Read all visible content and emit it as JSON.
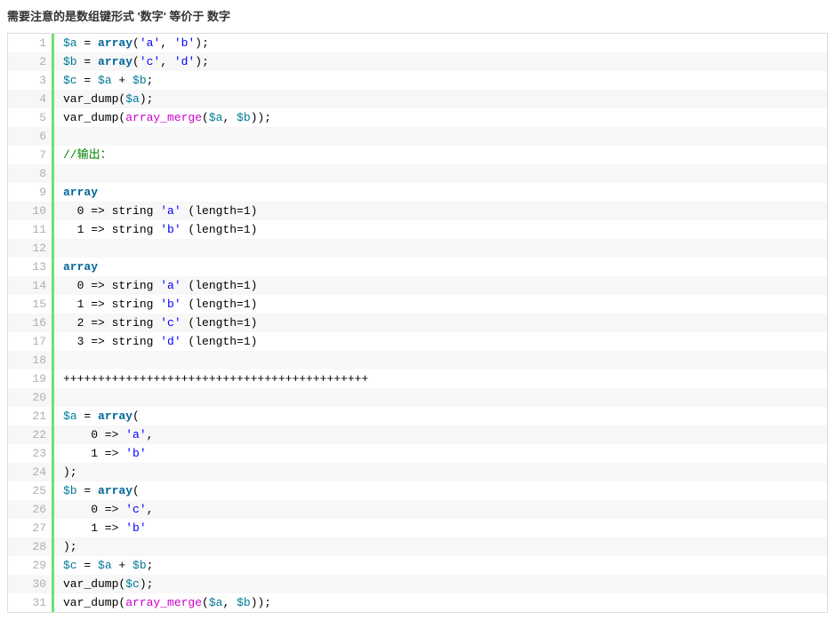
{
  "heading": "需要注意的是数组键形式 '数字' 等价于 数字",
  "lines": [
    {
      "n": "1",
      "tokens": [
        [
          "t-var",
          "$a"
        ],
        [
          "t-pl",
          " = "
        ],
        [
          "t-kw",
          "array"
        ],
        [
          "t-pl",
          "("
        ],
        [
          "t-str",
          "'a'"
        ],
        [
          "t-pl",
          ", "
        ],
        [
          "t-str",
          "'b'"
        ],
        [
          "t-pl",
          ");"
        ]
      ]
    },
    {
      "n": "2",
      "tokens": [
        [
          "t-var",
          "$b"
        ],
        [
          "t-pl",
          " = "
        ],
        [
          "t-kw",
          "array"
        ],
        [
          "t-pl",
          "("
        ],
        [
          "t-str",
          "'c'"
        ],
        [
          "t-pl",
          ", "
        ],
        [
          "t-str",
          "'d'"
        ],
        [
          "t-pl",
          ");"
        ]
      ]
    },
    {
      "n": "3",
      "tokens": [
        [
          "t-var",
          "$c"
        ],
        [
          "t-pl",
          " = "
        ],
        [
          "t-var",
          "$a"
        ],
        [
          "t-pl",
          " + "
        ],
        [
          "t-var",
          "$b"
        ],
        [
          "t-pl",
          ";"
        ]
      ]
    },
    {
      "n": "4",
      "tokens": [
        [
          "t-pl",
          "var_dump("
        ],
        [
          "t-var",
          "$a"
        ],
        [
          "t-pl",
          ");"
        ]
      ]
    },
    {
      "n": "5",
      "tokens": [
        [
          "t-pl",
          "var_dump("
        ],
        [
          "t-fn",
          "array_merge"
        ],
        [
          "t-pl",
          "("
        ],
        [
          "t-var",
          "$a"
        ],
        [
          "t-pl",
          ", "
        ],
        [
          "t-var",
          "$b"
        ],
        [
          "t-pl",
          "));"
        ]
      ]
    },
    {
      "n": "6",
      "tokens": [
        [
          "t-pl",
          ""
        ]
      ]
    },
    {
      "n": "7",
      "tokens": [
        [
          "t-com",
          "//输出："
        ]
      ]
    },
    {
      "n": "8",
      "tokens": [
        [
          "t-pl",
          ""
        ]
      ]
    },
    {
      "n": "9",
      "tokens": [
        [
          "t-kw",
          "array"
        ]
      ]
    },
    {
      "n": "10",
      "tokens": [
        [
          "t-pl",
          "  0 => string "
        ],
        [
          "t-str",
          "'a'"
        ],
        [
          "t-pl",
          " (length=1)"
        ]
      ]
    },
    {
      "n": "11",
      "tokens": [
        [
          "t-pl",
          "  1 => string "
        ],
        [
          "t-str",
          "'b'"
        ],
        [
          "t-pl",
          " (length=1)"
        ]
      ]
    },
    {
      "n": "12",
      "tokens": [
        [
          "t-pl",
          ""
        ]
      ]
    },
    {
      "n": "13",
      "tokens": [
        [
          "t-kw",
          "array"
        ]
      ]
    },
    {
      "n": "14",
      "tokens": [
        [
          "t-pl",
          "  0 => string "
        ],
        [
          "t-str",
          "'a'"
        ],
        [
          "t-pl",
          " (length=1)"
        ]
      ]
    },
    {
      "n": "15",
      "tokens": [
        [
          "t-pl",
          "  1 => string "
        ],
        [
          "t-str",
          "'b'"
        ],
        [
          "t-pl",
          " (length=1)"
        ]
      ]
    },
    {
      "n": "16",
      "tokens": [
        [
          "t-pl",
          "  2 => string "
        ],
        [
          "t-str",
          "'c'"
        ],
        [
          "t-pl",
          " (length=1)"
        ]
      ]
    },
    {
      "n": "17",
      "tokens": [
        [
          "t-pl",
          "  3 => string "
        ],
        [
          "t-str",
          "'d'"
        ],
        [
          "t-pl",
          " (length=1)"
        ]
      ]
    },
    {
      "n": "18",
      "tokens": [
        [
          "t-pl",
          ""
        ]
      ]
    },
    {
      "n": "19",
      "tokens": [
        [
          "t-pl",
          "++++++++++++++++++++++++++++++++++++++++++++"
        ]
      ]
    },
    {
      "n": "20",
      "tokens": [
        [
          "t-pl",
          ""
        ]
      ]
    },
    {
      "n": "21",
      "tokens": [
        [
          "t-var",
          "$a"
        ],
        [
          "t-pl",
          " = "
        ],
        [
          "t-kw",
          "array"
        ],
        [
          "t-pl",
          "("
        ]
      ]
    },
    {
      "n": "22",
      "tokens": [
        [
          "t-pl",
          "    0 => "
        ],
        [
          "t-str",
          "'a'"
        ],
        [
          "t-pl",
          ","
        ]
      ]
    },
    {
      "n": "23",
      "tokens": [
        [
          "t-pl",
          "    1 => "
        ],
        [
          "t-str",
          "'b'"
        ]
      ]
    },
    {
      "n": "24",
      "tokens": [
        [
          "t-pl",
          ");"
        ]
      ]
    },
    {
      "n": "25",
      "tokens": [
        [
          "t-var",
          "$b"
        ],
        [
          "t-pl",
          " = "
        ],
        [
          "t-kw",
          "array"
        ],
        [
          "t-pl",
          "("
        ]
      ]
    },
    {
      "n": "26",
      "tokens": [
        [
          "t-pl",
          "    0 => "
        ],
        [
          "t-str",
          "'c'"
        ],
        [
          "t-pl",
          ","
        ]
      ]
    },
    {
      "n": "27",
      "tokens": [
        [
          "t-pl",
          "    1 => "
        ],
        [
          "t-str",
          "'b'"
        ]
      ]
    },
    {
      "n": "28",
      "tokens": [
        [
          "t-pl",
          ");"
        ]
      ]
    },
    {
      "n": "29",
      "tokens": [
        [
          "t-var",
          "$c"
        ],
        [
          "t-pl",
          " = "
        ],
        [
          "t-var",
          "$a"
        ],
        [
          "t-pl",
          " + "
        ],
        [
          "t-var",
          "$b"
        ],
        [
          "t-pl",
          ";"
        ]
      ]
    },
    {
      "n": "30",
      "tokens": [
        [
          "t-pl",
          "var_dump("
        ],
        [
          "t-var",
          "$c"
        ],
        [
          "t-pl",
          ");"
        ]
      ]
    },
    {
      "n": "31",
      "tokens": [
        [
          "t-pl",
          "var_dump("
        ],
        [
          "t-fn",
          "array_merge"
        ],
        [
          "t-pl",
          "("
        ],
        [
          "t-var",
          "$a"
        ],
        [
          "t-pl",
          ", "
        ],
        [
          "t-var",
          "$b"
        ],
        [
          "t-pl",
          "));"
        ]
      ]
    }
  ]
}
